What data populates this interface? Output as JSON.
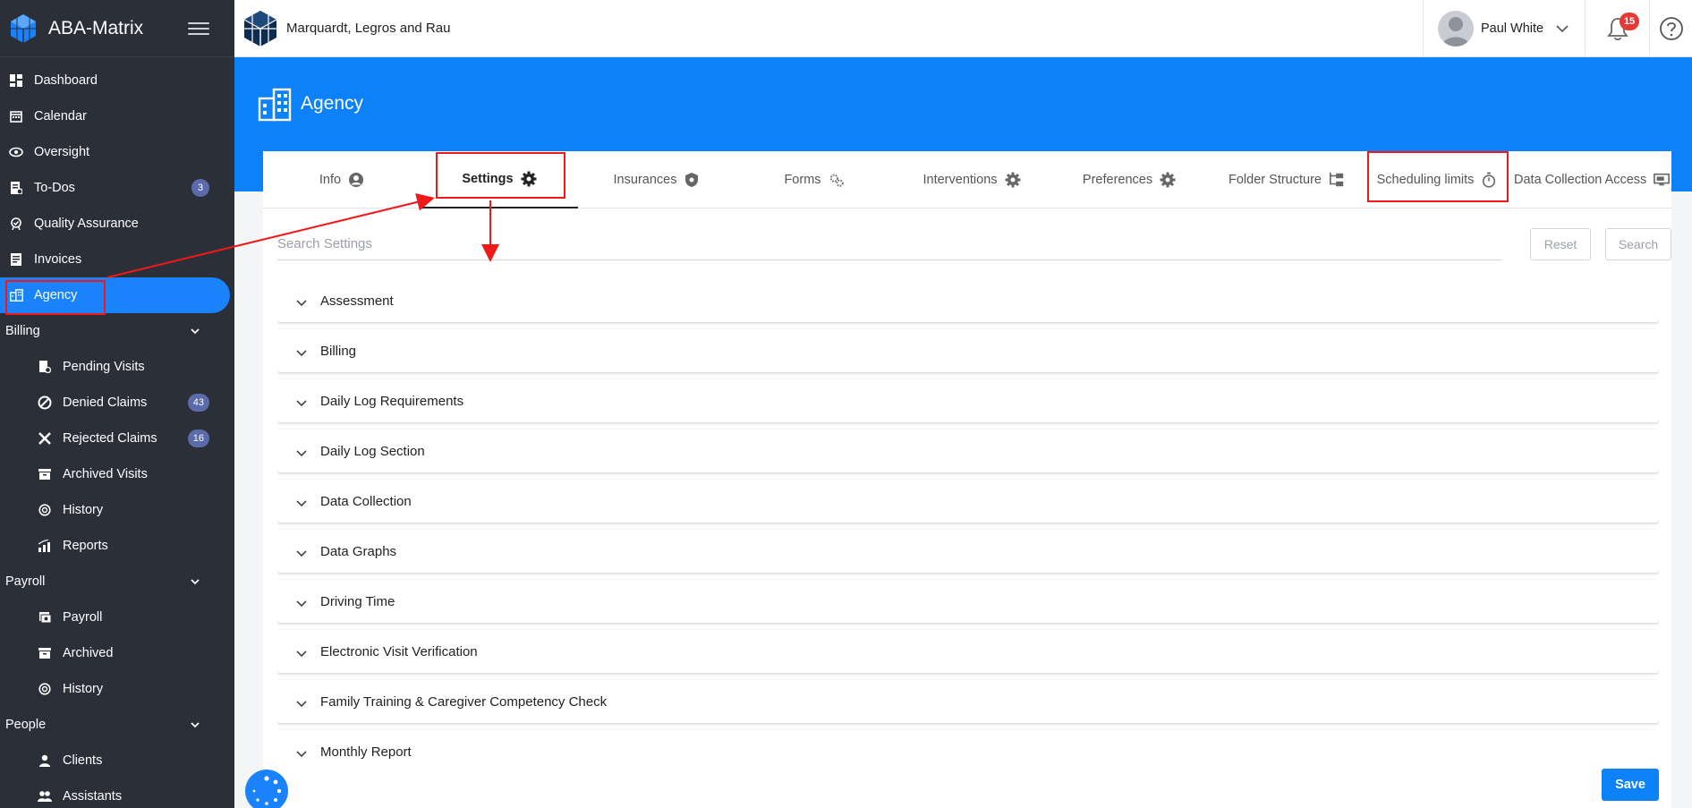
{
  "app": {
    "brand": "ABA-Matrix"
  },
  "topbar": {
    "org_name": "Marquardt, Legros and Rau",
    "user_name": "Paul White",
    "notification_count": "15"
  },
  "sidebar": {
    "items": [
      {
        "label": "Dashboard",
        "icon": "dashboard-icon"
      },
      {
        "label": "Calendar",
        "icon": "calendar-icon"
      },
      {
        "label": "Oversight",
        "icon": "eye-icon"
      },
      {
        "label": "To-Dos",
        "icon": "todo-icon",
        "badge": "3"
      },
      {
        "label": "Quality Assurance",
        "icon": "quality-icon"
      },
      {
        "label": "Invoices",
        "icon": "invoice-icon"
      },
      {
        "label": "Agency",
        "icon": "building-icon",
        "active": true
      }
    ],
    "billing": {
      "label": "Billing",
      "items": [
        {
          "label": "Pending Visits",
          "icon": "pending-icon"
        },
        {
          "label": "Denied Claims",
          "icon": "denied-icon",
          "badge": "43"
        },
        {
          "label": "Rejected Claims",
          "icon": "x-icon",
          "badge": "16"
        },
        {
          "label": "Archived Visits",
          "icon": "archive-icon"
        },
        {
          "label": "History",
          "icon": "history-icon"
        },
        {
          "label": "Reports",
          "icon": "reports-icon"
        }
      ]
    },
    "payroll": {
      "label": "Payroll",
      "items": [
        {
          "label": "Payroll",
          "icon": "payroll-icon"
        },
        {
          "label": "Archived",
          "icon": "archive-icon"
        },
        {
          "label": "History",
          "icon": "history-icon"
        }
      ]
    },
    "people": {
      "label": "People",
      "items": [
        {
          "label": "Clients",
          "icon": "person-icon"
        },
        {
          "label": "Assistants",
          "icon": "people-icon"
        }
      ]
    }
  },
  "page": {
    "title": "Agency"
  },
  "tabs": [
    {
      "label": "Info",
      "icon": "user-circle-icon"
    },
    {
      "label": "Settings",
      "icon": "gear-icon",
      "active": true
    },
    {
      "label": "Insurances",
      "icon": "shield-icon"
    },
    {
      "label": "Forms",
      "icon": "gears-icon"
    },
    {
      "label": "Interventions",
      "icon": "gear-icon"
    },
    {
      "label": "Preferences",
      "icon": "gear-icon"
    },
    {
      "label": "Folder Structure",
      "icon": "folder-tree-icon"
    },
    {
      "label": "Scheduling limits",
      "icon": "stopwatch-icon"
    },
    {
      "label": "Data Collection Access",
      "icon": "monitor-icon"
    }
  ],
  "search": {
    "placeholder": "Search Settings",
    "reset_label": "Reset",
    "search_label": "Search"
  },
  "sections": [
    "Assessment",
    "Billing",
    "Daily Log Requirements",
    "Daily Log Section",
    "Data Collection",
    "Data Graphs",
    "Driving Time",
    "Electronic Visit Verification",
    "Family Training & Caregiver Competency Check",
    "Monthly Report"
  ],
  "actions": {
    "save_label": "Save"
  },
  "colors": {
    "primary": "#0d81f7",
    "sidebar_bg": "#2b2f38",
    "annotation": "#f01818",
    "badge": "#5b6aa8"
  }
}
